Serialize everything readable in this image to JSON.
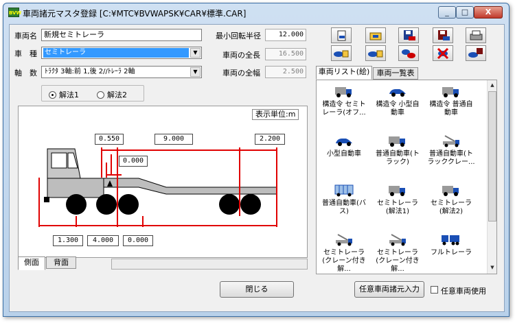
{
  "window": {
    "title": "車両諸元マスタ登録 [C:¥MTC¥BVWAPSK¥CAR¥標準.CAR]",
    "icon_text": "BVW",
    "min": "_",
    "max": "□",
    "close": "X"
  },
  "form": {
    "name_label": "車両名",
    "name_value": "新規セミトレーラ",
    "type_label": "車　種",
    "type_value": "セミトレーラ",
    "axle_label": "軸　数",
    "axle_value": "ﾄﾗｸﾀ 3軸:前 1,後 2//ﾄﾚｰﾗ 2軸",
    "min_radius_label": "最小回転半径",
    "min_radius_value": "12.000",
    "length_label": "車両の全長",
    "length_value": "16.500",
    "width_label": "車両の全幅",
    "width_value": "2.500"
  },
  "method": {
    "opt1": "解法1",
    "opt2": "解法2"
  },
  "diagram": {
    "unit_label": "表示単位:m",
    "dims": {
      "top1": "0.550",
      "top2": "9.000",
      "top3": "2.200",
      "inner": "0.000",
      "bot1": "1.300",
      "bot2": "4.000",
      "bot3": "0.000"
    }
  },
  "bottom_tabs": {
    "side": "側面",
    "back": "背面"
  },
  "list_tabs": {
    "icons": "車両リスト(絵)",
    "table": "車両一覧表"
  },
  "vehicles": [
    {
      "label": "構造令 セミトレーラ(オフ...",
      "icon": "gray-truck-icon"
    },
    {
      "label": "構造令 小型自動車",
      "icon": "blue-car-icon"
    },
    {
      "label": "構造令 普通自動車",
      "icon": "gray-truck-icon"
    },
    {
      "label": "小型自動車",
      "icon": "blue-car-icon"
    },
    {
      "label": "普通自動車(トラック)",
      "icon": "gray-truck-icon"
    },
    {
      "label": "普通自動車(トラッククレー...",
      "icon": "crane-truck-icon"
    },
    {
      "label": "普通自動車(バス)",
      "icon": "bus-icon"
    },
    {
      "label": "セミトレーラ(解法1)",
      "icon": "gray-truck-icon"
    },
    {
      "label": "セミトレーラ(解法2)",
      "icon": "gray-truck-icon"
    },
    {
      "label": "セミトレーラ(クレーン付き解...",
      "icon": "crane-truck-icon"
    },
    {
      "label": "セミトレーラ(クレーン付き解...",
      "icon": "crane-truck-icon"
    },
    {
      "label": "フルトレーラ",
      "icon": "full-trailer-icon"
    }
  ],
  "buttons": {
    "close": "閉じる",
    "custom": "任意車両諸元入力",
    "custom_use": "任意車両使用"
  }
}
